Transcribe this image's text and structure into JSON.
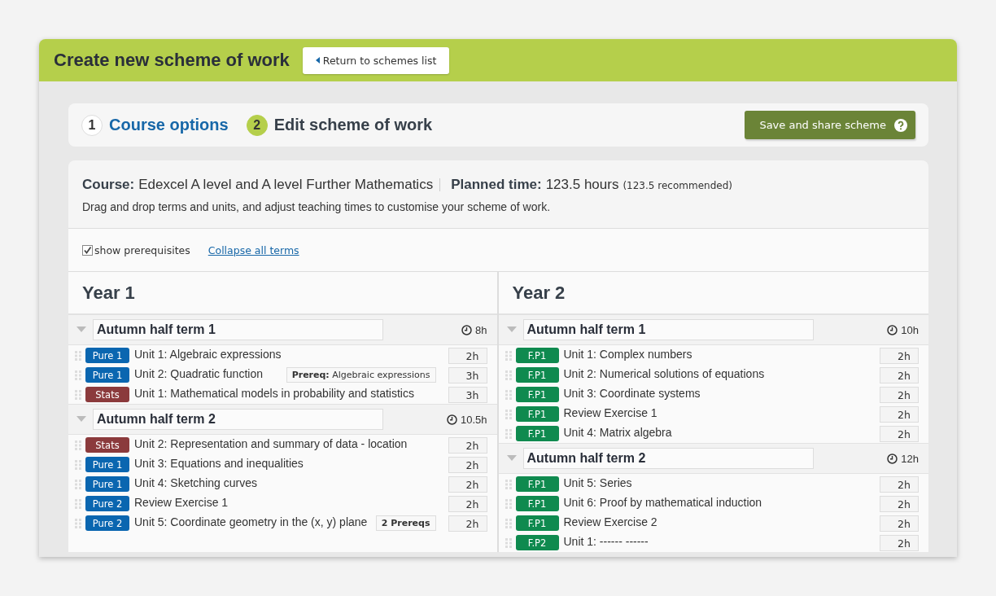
{
  "header": {
    "title": "Create new scheme of work",
    "back_button": "Return to schemes list"
  },
  "steps": [
    {
      "number": "1",
      "label": "Course options",
      "selected": false
    },
    {
      "number": "2",
      "label": "Edit scheme of work",
      "selected": true
    }
  ],
  "save_button": "Save and share scheme",
  "summary": {
    "course_label": "Course:",
    "course": "Edexcel A level and A level Further Mathematics",
    "planned_label": "Planned time:",
    "planned": "123.5 hours",
    "recommended": "(123.5 recommended)",
    "instructions": "Drag and drop terms and units, and adjust teaching times to customise your scheme of work."
  },
  "options": {
    "show_prerequisites": {
      "label": "show prerequisites",
      "checked": true
    },
    "collapse_link": "Collapse all terms"
  },
  "years": [
    {
      "title": "Year 1",
      "terms": [
        {
          "title": "Autumn half term 1",
          "hours": "8h",
          "expanded": true,
          "units": [
            {
              "tag": "Pure 1",
              "color": "#0a66b0",
              "title": "Unit 1: Algebraic expressions",
              "time": "2h"
            },
            {
              "tag": "Pure 1",
              "color": "#0a66b0",
              "title": "Unit 2: Quadratic function",
              "prereq": "**Prereq:** Algebraic expressions",
              "time": "3h"
            },
            {
              "tag": "Stats",
              "color": "#8b3a3c",
              "title": "Unit 1: Mathematical models in probability and statistics",
              "time": "3h"
            }
          ]
        },
        {
          "title": "Autumn half term 2",
          "hours": "10.5h",
          "expanded": true,
          "units": [
            {
              "tag": "Stats",
              "color": "#8b3a3c",
              "title": "Unit 2: Representation and summary of data - location",
              "time": "2h"
            },
            {
              "tag": "Pure 1",
              "color": "#0a66b0",
              "title": "Unit 3: Equations and inequalities",
              "time": "2h"
            },
            {
              "tag": "Pure 1",
              "color": "#0a66b0",
              "title": "Unit 4: Sketching curves",
              "time": "2h"
            },
            {
              "tag": "Pure 2",
              "color": "#0a66b0",
              "title": "Review Exercise 1",
              "time": "2h"
            },
            {
              "tag": "Pure 2",
              "color": "#0a66b0",
              "title": "Unit 5: Coordinate geometry in the (x, y) plane",
              "prereq": "**2 Prereqs**",
              "time": "2h"
            }
          ]
        }
      ]
    },
    {
      "title": "Year 2",
      "terms": [
        {
          "title": "Autumn half term 1",
          "hours": "10h",
          "expanded": true,
          "units": [
            {
              "tag": "F.P1",
              "color": "#0f8a4f",
              "title": "Unit 1: Complex numbers",
              "time": "2h"
            },
            {
              "tag": "F.P1",
              "color": "#0f8a4f",
              "title": "Unit 2: Numerical solutions of equations",
              "time": "2h"
            },
            {
              "tag": "F.P1",
              "color": "#0f8a4f",
              "title": "Unit 3: Coordinate systems",
              "time": "2h"
            },
            {
              "tag": "F.P1",
              "color": "#0f8a4f",
              "title": "Review Exercise 1",
              "time": "2h"
            },
            {
              "tag": "F.P1",
              "color": "#0f8a4f",
              "title": "Unit 4: Matrix algebra",
              "time": "2h"
            }
          ]
        },
        {
          "title": "Autumn half term 2",
          "hours": "12h",
          "expanded": true,
          "units": [
            {
              "tag": "F.P1",
              "color": "#0f8a4f",
              "title": "Unit 5: Series",
              "time": "2h"
            },
            {
              "tag": "F.P1",
              "color": "#0f8a4f",
              "title": "Unit 6: Proof by mathematical induction",
              "time": "2h"
            },
            {
              "tag": "F.P1",
              "color": "#0f8a4f",
              "title": "Review Exercise 2",
              "time": "2h"
            },
            {
              "tag": "F.P2",
              "color": "#0f8a4f",
              "title": "Unit 1: ------ ------",
              "time": "2h"
            }
          ]
        }
      ]
    }
  ]
}
